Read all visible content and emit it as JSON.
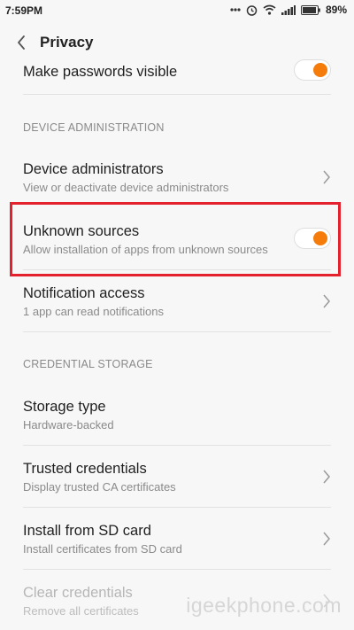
{
  "status_bar": {
    "time": "7:59PM",
    "battery": "89%",
    "icons": [
      "dots-icon",
      "alarm-icon",
      "wifi-icon",
      "signal-icon",
      "battery-icon"
    ]
  },
  "header": {
    "title": "Privacy",
    "back_icon": "chevron-left-icon"
  },
  "items": {
    "make_passwords_visible": {
      "title": "Make passwords visible",
      "toggle_on": true
    },
    "device_admins": {
      "title": "Device administrators",
      "subtitle": "View or deactivate device administrators"
    },
    "unknown_sources": {
      "title": "Unknown sources",
      "subtitle": "Allow installation of apps from unknown sources",
      "toggle_on": true
    },
    "notification_access": {
      "title": "Notification access",
      "subtitle": "1 app can read notifications"
    },
    "storage_type": {
      "title": "Storage type",
      "subtitle": "Hardware-backed"
    },
    "trusted_credentials": {
      "title": "Trusted credentials",
      "subtitle": "Display trusted CA certificates"
    },
    "install_from_sd": {
      "title": "Install from SD card",
      "subtitle": "Install certificates from SD card"
    },
    "clear_credentials": {
      "title": "Clear credentials",
      "subtitle": "Remove all certificates",
      "enabled": false
    }
  },
  "sections": {
    "device_admin": "DEVICE ADMINISTRATION",
    "credential_storage": "CREDENTIAL STORAGE"
  },
  "colors": {
    "accent": "#f57c0a",
    "highlight_box": "#e3222d",
    "background": "#f7f7f7"
  },
  "watermark": "igeekphone.com"
}
